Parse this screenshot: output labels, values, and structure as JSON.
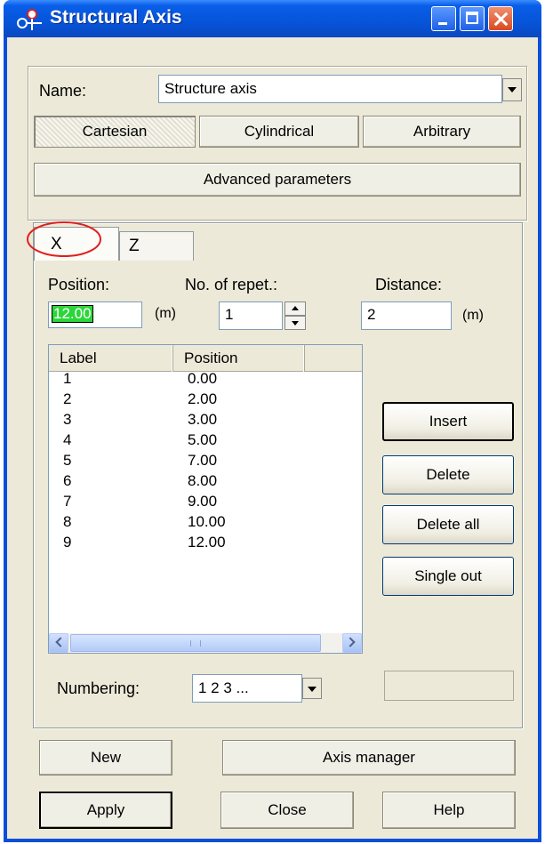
{
  "window": {
    "title": "Structural Axis"
  },
  "name_field": {
    "label": "Name:",
    "value": "Structure axis"
  },
  "coord_buttons": [
    {
      "label": "Cartesian",
      "pressed": true
    },
    {
      "label": "Cylindrical",
      "pressed": false
    },
    {
      "label": "Arbitrary",
      "pressed": false
    }
  ],
  "advanced_button": "Advanced parameters",
  "tabs": [
    {
      "label": "X",
      "active": true
    },
    {
      "label": "Z",
      "active": false
    }
  ],
  "position": {
    "label": "Position:",
    "value": "12.00",
    "unit": "(m)"
  },
  "repetitions": {
    "label": "No. of repet.:",
    "value": "1"
  },
  "distance": {
    "label": "Distance:",
    "value": "2",
    "unit": "(m)"
  },
  "axis_list": {
    "columns": [
      "Label",
      "Position"
    ],
    "rows": [
      [
        "1",
        "0.00"
      ],
      [
        "2",
        "2.00"
      ],
      [
        "3",
        "3.00"
      ],
      [
        "4",
        "5.00"
      ],
      [
        "5",
        "7.00"
      ],
      [
        "6",
        "8.00"
      ],
      [
        "7",
        "9.00"
      ],
      [
        "8",
        "10.00"
      ],
      [
        "9",
        "12.00"
      ]
    ]
  },
  "side_buttons": {
    "insert": "Insert",
    "delete": "Delete",
    "delete_all": "Delete all",
    "single_out": "Single out"
  },
  "numbering": {
    "label": "Numbering:",
    "value": "1 2 3 ..."
  },
  "bottom_buttons": {
    "new": "New",
    "axis_manager": "Axis manager",
    "apply": "Apply",
    "close": "Close",
    "help": "Help"
  },
  "colors": {
    "titlebar": "#0a5ee8",
    "position_highlight": "#2bd63a",
    "annotation_circle": "#e0201c"
  }
}
